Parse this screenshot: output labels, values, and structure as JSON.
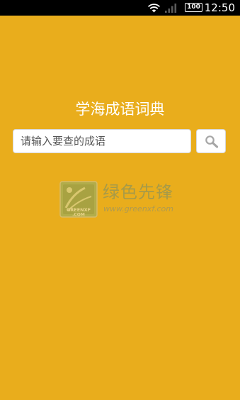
{
  "status_bar": {
    "time": "12:50",
    "battery_level": "100",
    "icons": [
      "wifi-icon",
      "signal-icon",
      "battery-icon"
    ]
  },
  "app": {
    "title": "学海成语词典"
  },
  "search": {
    "placeholder": "请输入要查的成语",
    "value": "",
    "button_icon": "search-icon"
  },
  "watermark": {
    "name": "绿色先锋",
    "url": "www.greenxf.com",
    "logo_text_line1": "GREENXF",
    "logo_text_line2": ".COM"
  },
  "colors": {
    "background": "#e9ad1c",
    "status_bar": "#000000",
    "title_text": "#ffffff",
    "input_background": "#ffffff",
    "input_border": "#d7d7d7"
  }
}
